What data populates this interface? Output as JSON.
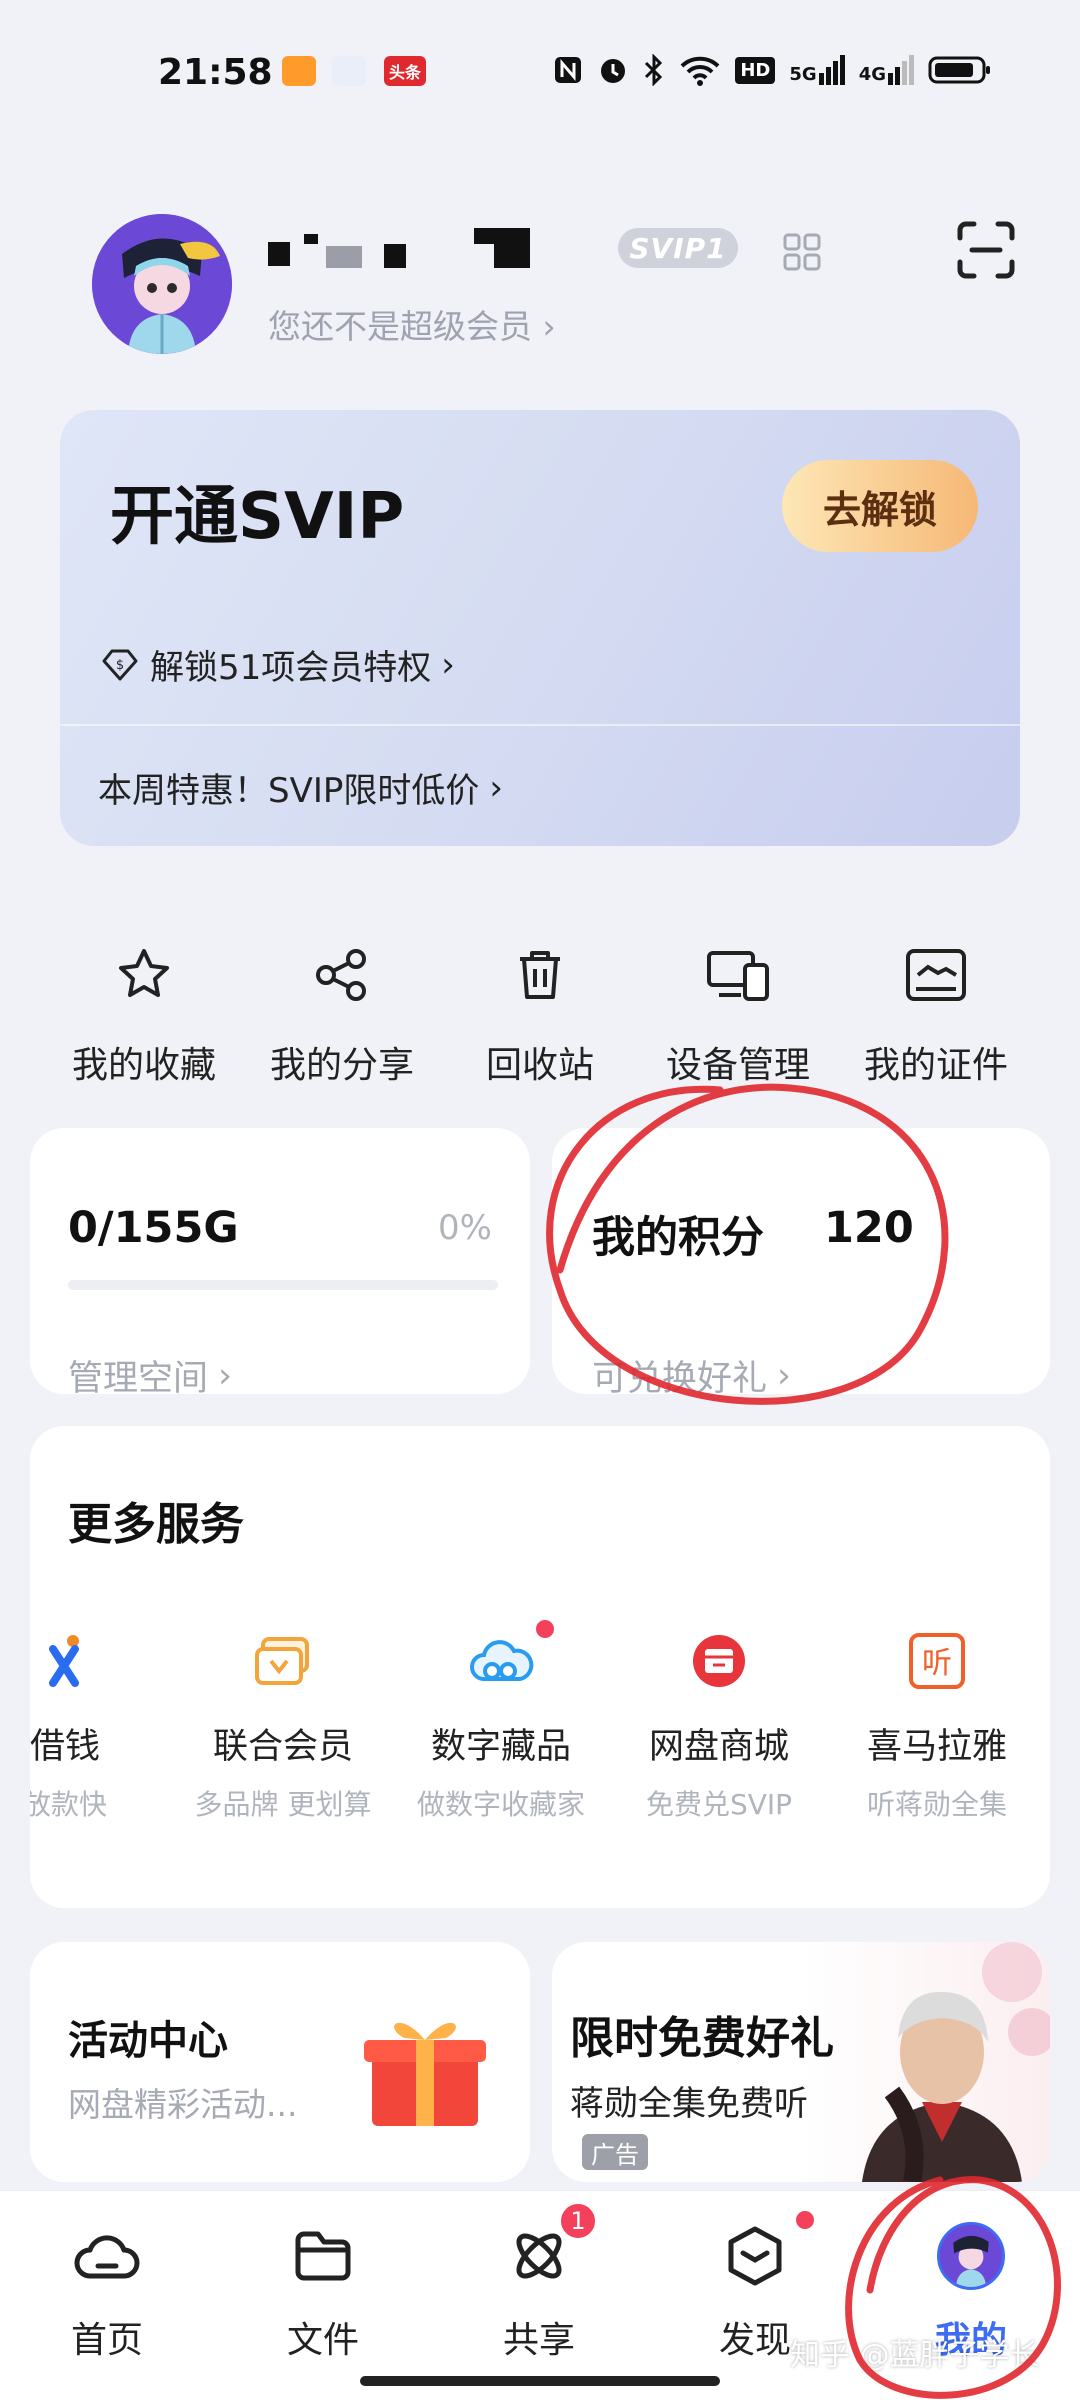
{
  "status_bar": {
    "time": "21:58",
    "app_badge": "头条",
    "signal_labels": [
      "HD",
      "5G",
      "4G"
    ]
  },
  "profile": {
    "svip_badge": "SVIP1",
    "member_status": "您还不是超级会员"
  },
  "svip_card": {
    "title": "开通SVIP",
    "unlock_button": "去解锁",
    "privilege_text": "解锁51项会员特权",
    "weekly_deal": "本周特惠！SVIP限时低价"
  },
  "quick_actions": [
    {
      "label": "我的收藏",
      "icon": "star-icon"
    },
    {
      "label": "我的分享",
      "icon": "share-icon"
    },
    {
      "label": "回收站",
      "icon": "trash-icon"
    },
    {
      "label": "设备管理",
      "icon": "devices-icon"
    },
    {
      "label": "我的证件",
      "icon": "id-card-icon"
    }
  ],
  "storage": {
    "value": "0/155G",
    "percent": "0%",
    "usage_fraction": 0,
    "manage_label": "管理空间"
  },
  "points": {
    "label": "我的积分",
    "value": "120",
    "redeem_label": "可兑换好礼"
  },
  "more_services": {
    "title": "更多服务",
    "items": [
      {
        "name": "借钱",
        "desc": "放款快",
        "icon": "loan-icon"
      },
      {
        "name": "联合会员",
        "desc": "多品牌 更划算",
        "icon": "vip-card-icon"
      },
      {
        "name": "数字藏品",
        "desc": "做数字收藏家",
        "icon": "cloud-icon"
      },
      {
        "name": "网盘商城",
        "desc": "免费兑SVIP",
        "icon": "store-icon"
      },
      {
        "name": "喜马拉雅",
        "desc": "听蒋勋全集",
        "icon": "ximalaya-icon"
      }
    ]
  },
  "activity_card": {
    "title": "活动中心",
    "subtitle": "网盘精彩活动..."
  },
  "promo_card": {
    "title": "限时免费好礼",
    "subtitle": "蒋勋全集免费听",
    "ad_tag": "广告"
  },
  "bottom_nav": {
    "items": [
      {
        "label": "首页",
        "icon": "home-cloud-icon"
      },
      {
        "label": "文件",
        "icon": "folder-icon"
      },
      {
        "label": "共享",
        "icon": "share-orbit-icon",
        "badge": "1"
      },
      {
        "label": "发现",
        "icon": "discover-icon"
      },
      {
        "label": "我的",
        "icon": "profile-avatar-icon",
        "active": true
      }
    ]
  },
  "watermark": "知乎 @蓝胖子学长",
  "colors": {
    "accent": "#3d6cf5",
    "badge_red": "#f4405b",
    "annotation_red": "#e0282f"
  }
}
